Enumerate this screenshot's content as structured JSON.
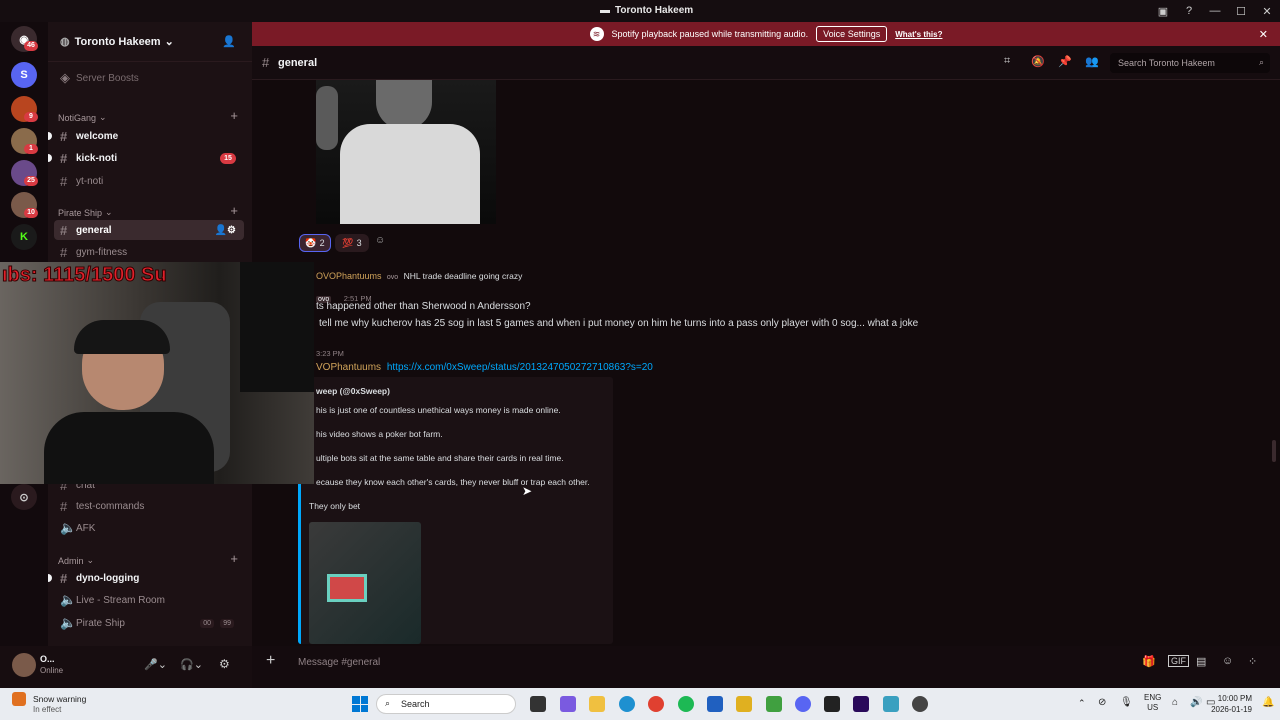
{
  "window": {
    "title": "Toronto Hakeem"
  },
  "notice": {
    "text": "Spotify playback paused while transmitting audio.",
    "button": "Voice Settings",
    "link": "What's this?"
  },
  "server": {
    "name": "Toronto Hakeem",
    "partial_item": "Server Boosts"
  },
  "guild_badges": {
    "top": "46",
    "g3": "9",
    "g4": "1",
    "g5": "25",
    "g6": "10"
  },
  "categories": {
    "notigang": "NotiGang",
    "pirate": "Pirate Ship",
    "admin": "Admin"
  },
  "channels": {
    "welcome": "welcome",
    "kick_noti": "kick-noti",
    "kick_noti_count": "15",
    "yt_noti": "yt-noti",
    "general": "general",
    "gym": "gym-fitness",
    "chat": "chat",
    "test_commands": "test-commands",
    "afk": "AFK",
    "dyno": "dyno-logging",
    "live_stream": "Live - Stream Room",
    "pirate_voice": "Pirate Ship",
    "pirate_voice_count1": "00",
    "pirate_voice_count2": "99"
  },
  "user": {
    "name": "O...",
    "status": "Online"
  },
  "header": {
    "channel": "general",
    "search_placeholder": "Search Toronto Hakeem"
  },
  "reactions": [
    {
      "emoji": "🤡",
      "count": "2"
    },
    {
      "emoji": "💯",
      "count": "3"
    }
  ],
  "messages": {
    "reply_author": "OVOPhantuums",
    "reply_badge": "ovo",
    "reply_text": "NHL trade deadline going crazy",
    "badge2": "ovo",
    "time1": "2:51 PM",
    "line1": "ts happened other than Sherwood n Andersson?",
    "line2": "tell me why kucherov has 25 sog in last 5 games and when i put money on him he turns into a pass only player with 0 sog... what a joke",
    "time2": "3:23 PM",
    "author2": "VOPhantuums",
    "link": "https://x.com/0xSweep/status/2013247050272710863?s=20"
  },
  "embed": {
    "author": "weep (@0xSweep)",
    "p1": "his is just one of countless unethical ways money is made online.",
    "p2": "his video shows a poker bot farm.",
    "p3": "ultiple bots sit at the same table and share their cards in real time.",
    "p4": "ecause they know each other's cards, they never bluff or trap each other.",
    "p5": "They only bet"
  },
  "overlay": {
    "subs": "ıbs: 1115/1500  Su"
  },
  "composer": {
    "placeholder": "Message #general"
  },
  "taskbar": {
    "weather_title": "Snow warning",
    "weather_sub": "In effect",
    "search": "Search",
    "lang": "ENG",
    "region": "US",
    "time": "10:00 PM",
    "date": "2026-01-19"
  },
  "colors": {
    "accent_red": "#d83a42",
    "notice_bg": "#7a1a26",
    "link": "#00a8fc"
  }
}
